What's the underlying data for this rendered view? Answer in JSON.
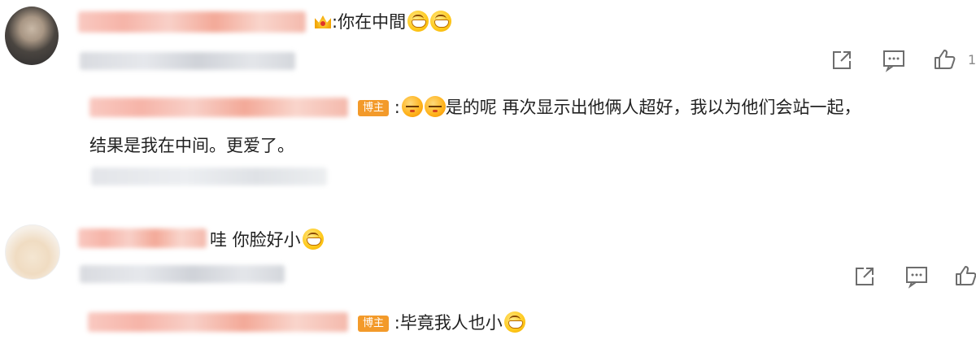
{
  "comments": [
    {
      "text": ":你在中間",
      "emojis": [
        "grin-icon",
        "grin-icon"
      ],
      "actions": {
        "like_count": "1"
      },
      "reply": {
        "badge": "博主",
        "line1": "是的呢 再次显示出他俩人超好，我以为他们会站一起，",
        "line2": "结果是我在中间。更爱了。"
      }
    },
    {
      "text": "哇 你脸好小",
      "emojis": [
        "grin-icon"
      ],
      "reply": {
        "badge": "博主",
        "text": ":毕竟我人也小"
      }
    }
  ]
}
